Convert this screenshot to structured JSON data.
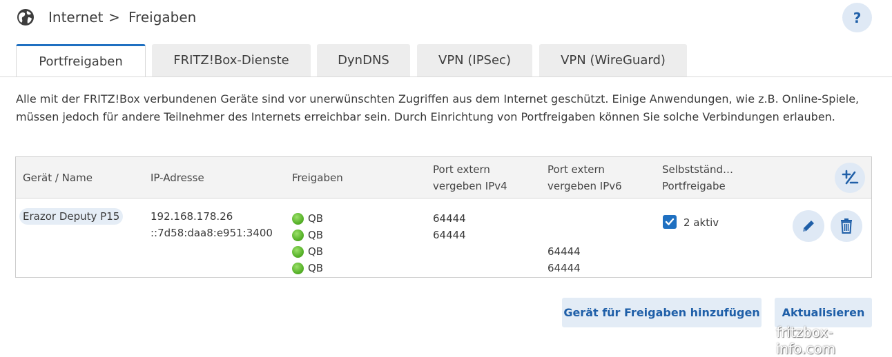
{
  "breadcrumb": {
    "section": "Internet",
    "separator": ">",
    "page": "Freigaben"
  },
  "help_label": "?",
  "tabs": [
    {
      "label": "Portfreigaben",
      "active": true
    },
    {
      "label": "FRITZ!Box-Dienste",
      "active": false
    },
    {
      "label": "DynDNS",
      "active": false
    },
    {
      "label": "VPN (IPSec)",
      "active": false
    },
    {
      "label": "VPN (WireGuard)",
      "active": false
    }
  ],
  "description": "Alle mit der FRITZ!Box verbundenen Geräte sind vor unerwünschten Zugriffen aus dem Internet geschützt. Einige Anwendungen, wie z.B. Online-Spiele, müssen jedoch für andere Teilnehmer des Internets erreichbar sein. Durch Einrichtung von Portfreigaben können Sie solche Verbindungen erlauben.",
  "table": {
    "headers": {
      "device": "Gerät / Name",
      "ip": "IP-Adresse",
      "shares": "Freigaben",
      "port_v4": [
        "Port extern",
        "vergeben IPv4"
      ],
      "port_v6": [
        "Port extern",
        "vergeben IPv6"
      ],
      "auto": [
        "Selbstständ…",
        "Portfreigabe"
      ]
    },
    "rows": [
      {
        "device": "Erazor Deputy P15",
        "ip": [
          "192.168.178.26",
          "::7d58:daa8:e951:3400"
        ],
        "shares": [
          "QB",
          "QB",
          "QB",
          "QB"
        ],
        "port_v4": [
          "64444",
          "64444"
        ],
        "port_v6": [
          "64444",
          "64444"
        ],
        "auto_checked": true,
        "auto_label": "2 aktiv"
      }
    ]
  },
  "buttons": {
    "add_device": "Gerät für Freigaben hinzufügen",
    "refresh": "Aktualisieren"
  },
  "watermark": "fritzbox-info.com",
  "colors": {
    "accent": "#1f70c1",
    "button_bg": "#e3ecf6",
    "status_green": "#58b32a"
  }
}
